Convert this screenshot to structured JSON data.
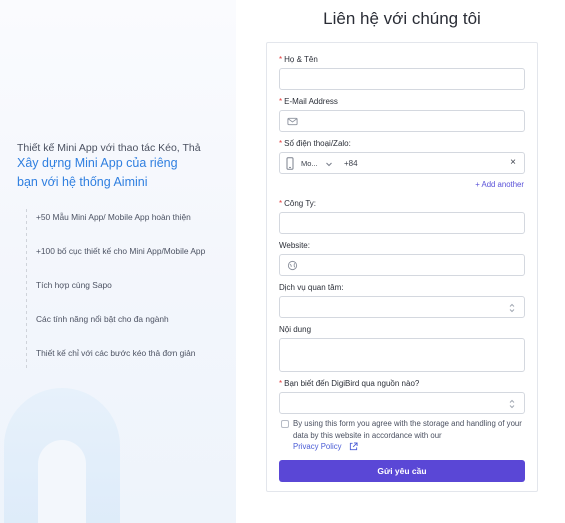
{
  "left": {
    "intro": "Thiết kế Mini App với thao tác Kéo, Thả",
    "headline_line1": "Xây dựng Mini App của riêng",
    "headline_line2": "bạn với hệ thống Aimini",
    "features": [
      "+50 Mẫu Mini App/ Mobile App hoàn thiện",
      "+100 bố cục thiết kế cho Mini App/Mobile App",
      "Tích hợp cùng Sapo",
      "Các tính năng nổi bật cho đa ngành",
      "Thiết kế chỉ với các bước kéo thả đơn giản"
    ]
  },
  "form": {
    "title": "Liên hệ với chúng tôi",
    "required_mark": "*",
    "name_label": "Họ & Tên",
    "email_label": "E-Mail Address",
    "phone_label": "Số điện thoại/Zalo:",
    "phone_country": "Mo...",
    "phone_code": "+84",
    "phone_clear": "×",
    "add_another": "+ Add another",
    "company_label": "Công Ty:",
    "website_label": "Website:",
    "service_label": "Dịch vụ quan tâm:",
    "content_label": "Nội dung",
    "source_label": "Bạn biết đến DigiBird qua nguồn nào?",
    "consent_text": "By using this form you agree with the storage and handling of your data by this website in accordance with our",
    "privacy_link": "Privacy Policy",
    "submit_label": "Gửi yêu cầu"
  },
  "colors": {
    "accent": "#5a47d6",
    "headline_blue": "#2f7fe0",
    "required_red": "#e23b3b"
  },
  "icons": [
    "mail-icon",
    "phone-icon",
    "chevron-down-icon",
    "globe-icon",
    "updown-icon",
    "external-link-icon"
  ]
}
